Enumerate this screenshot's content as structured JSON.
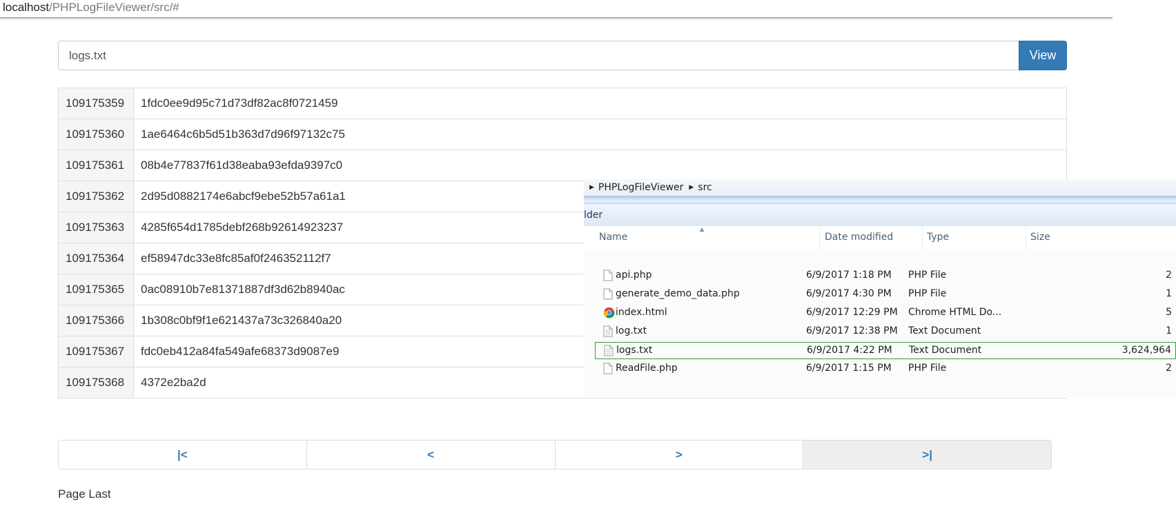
{
  "browser": {
    "url_host": "localhost",
    "url_path": "/PHPLogFileViewer/src/#"
  },
  "search": {
    "value": "logs.txt",
    "button_label": "View"
  },
  "log_rows": [
    {
      "line": "109175359",
      "text": "1fdc0ee9d95c71d73df82ac8f0721459"
    },
    {
      "line": "109175360",
      "text": "1ae6464c6b5d51b363d7d96f97132c75"
    },
    {
      "line": "109175361",
      "text": "08b4e77837f61d38eaba93efda9397c0"
    },
    {
      "line": "109175362",
      "text": "2d95d0882174e6abcf9ebe52b57a61a1"
    },
    {
      "line": "109175363",
      "text": "4285f654d1785debf268b92614923237"
    },
    {
      "line": "109175364",
      "text": "ef58947dc33e8fc85af0f246352112f7"
    },
    {
      "line": "109175365",
      "text": "0ac08910b7e81371887df3d62b8940ac"
    },
    {
      "line": "109175366",
      "text": "1b308c0bf9f1e621437a73c326840a20"
    },
    {
      "line": "109175367",
      "text": "fdc0eb412a84fa549afe68373d9087e9"
    },
    {
      "line": "109175368",
      "text": "4372e2ba2d"
    }
  ],
  "pager": {
    "first": "|<",
    "prev": "<",
    "next": ">",
    "last": ">|"
  },
  "page_status": "Page Last",
  "explorer": {
    "breadcrumb": [
      "PHPLogFileViewer",
      "src"
    ],
    "toolbar_text": "lder",
    "columns": {
      "name": "Name",
      "date": "Date modified",
      "type": "Type",
      "size": "Size"
    },
    "files": [
      {
        "name": "api.php",
        "date": "6/9/2017 1:18 PM",
        "type": "PHP File",
        "size": "2",
        "icon": "file-icon"
      },
      {
        "name": "generate_demo_data.php",
        "date": "6/9/2017 4:30 PM",
        "type": "PHP File",
        "size": "1",
        "icon": "file-icon"
      },
      {
        "name": "index.html",
        "date": "6/9/2017 12:29 PM",
        "type": "Chrome HTML Do...",
        "size": "5",
        "icon": "chrome-icon"
      },
      {
        "name": "log.txt",
        "date": "6/9/2017 12:38 PM",
        "type": "Text Document",
        "size": "1",
        "icon": "text-file-icon"
      },
      {
        "name": "logs.txt",
        "date": "6/9/2017 4:22 PM",
        "type": "Text Document",
        "size": "3,624,964",
        "icon": "text-file-icon",
        "selected": true
      },
      {
        "name": "ReadFile.php",
        "date": "6/9/2017 1:15 PM",
        "type": "PHP File",
        "size": "2",
        "icon": "file-icon"
      }
    ]
  },
  "colors": {
    "primary": "#337ab7",
    "selection_border": "#2e9a47"
  }
}
